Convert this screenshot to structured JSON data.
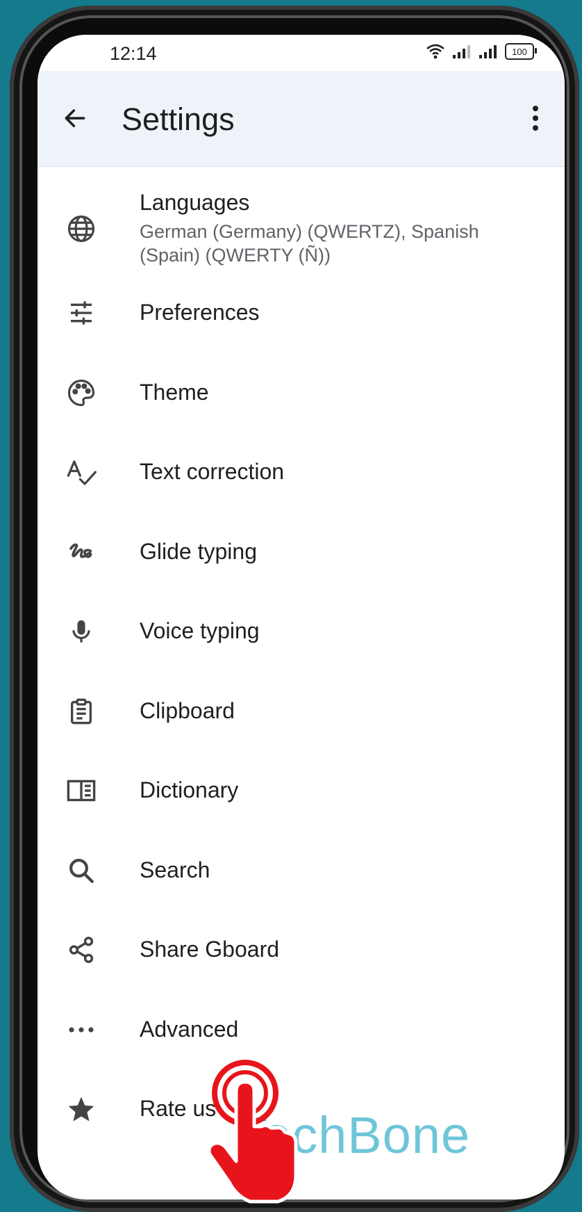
{
  "status_bar": {
    "time": "12:14",
    "battery": "100"
  },
  "app_bar": {
    "title": "Settings"
  },
  "items": [
    {
      "label": "Languages",
      "sub": "German (Germany) (QWERTZ), Spanish (Spain) (QWERTY (Ñ))",
      "icon": "globe-icon"
    },
    {
      "label": "Preferences",
      "icon": "sliders-icon"
    },
    {
      "label": "Theme",
      "icon": "palette-icon"
    },
    {
      "label": "Text correction",
      "icon": "spellcheck-icon"
    },
    {
      "label": "Glide typing",
      "icon": "gesture-icon"
    },
    {
      "label": "Voice typing",
      "icon": "microphone-icon"
    },
    {
      "label": "Clipboard",
      "icon": "clipboard-icon"
    },
    {
      "label": "Dictionary",
      "icon": "book-icon"
    },
    {
      "label": "Search",
      "icon": "search-icon"
    },
    {
      "label": "Share Gboard",
      "icon": "share-icon"
    },
    {
      "label": "Advanced",
      "icon": "more-horiz-icon"
    },
    {
      "label": "Rate us",
      "icon": "star-icon"
    }
  ],
  "watermark": "TechBone",
  "colors": {
    "background": "#147a8c",
    "app_bar": "#eef2f9",
    "tap_indicator": "#e8141c",
    "watermark": "#6ec6d8"
  }
}
